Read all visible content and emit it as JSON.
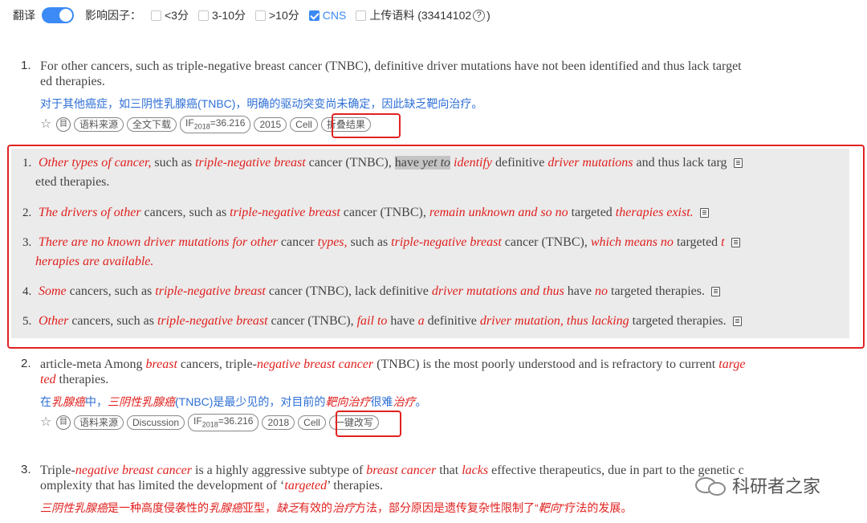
{
  "filter": {
    "translate_label": "翻译",
    "impact_label": "影响因子：",
    "options": [
      {
        "label": "<3分",
        "checked": false
      },
      {
        "label": "3-10分",
        "checked": false
      },
      {
        "label": ">10分",
        "checked": false
      },
      {
        "label": "CNS",
        "checked": true
      },
      {
        "label": "上传语料 (33414102",
        "checked": false
      }
    ],
    "help": "?",
    "close_paren": ")"
  },
  "entries": [
    {
      "num": "1.",
      "en_line1": "For other cancers, such as triple-negative breast cancer (TNBC), definitive driver mutations have not been identified and thus lack target",
      "en_line2": "ed therapies.",
      "zh": "对于其他癌症，如三阴性乳腺癌(TNBC)，明确的驱动突变尚未确定，因此缺乏靶向治疗。",
      "tags": [
        "语料来源",
        "全文下载",
        "IF",
        "2018",
        "=36.216",
        "2015",
        "Cell",
        "折叠结果"
      ],
      "icon_text": "目"
    },
    {
      "num": "2.",
      "en_parts": [
        "article-meta Among ",
        "breast",
        " cancers, triple-",
        "negative breast cancer",
        " (TNBC) is the most poorly understood and is refractory to current ",
        "targe"
      ],
      "en_line2_parts": [
        "ted",
        " therapies."
      ],
      "zh_parts": [
        "在",
        "乳腺癌",
        "中，",
        "三阴性乳腺癌",
        "(TNBC)是最少见的，对目前的",
        "靶向治疗",
        "很难",
        "治疗",
        "。"
      ],
      "tags": [
        "语料来源",
        "Discussion",
        "IF",
        "2018",
        "=36.216",
        "2018",
        "Cell",
        "一键改写"
      ],
      "icon_text": "目"
    },
    {
      "num": "3.",
      "en_parts": [
        "Triple-",
        "negative breast cancer",
        " is a highly aggressive subtype of ",
        "breast cancer",
        " that ",
        "lacks",
        " effective therapeutics, due in part to the genetic c"
      ],
      "en_line2_parts": [
        "omplexity that has limited the development of ‘",
        "targeted",
        "’ therapies."
      ],
      "zh_parts": [
        "三阴性乳腺癌",
        "是一种高度侵袭性的",
        "乳腺癌",
        "亚型，",
        "缺乏",
        "有效的",
        "治疗",
        "方法，部分原因是遗传复杂性限制了“",
        "靶向",
        "”疗法的发展。"
      ]
    }
  ],
  "alternatives": [
    {
      "num": "1.",
      "parts": [
        "Other types of cancer,",
        " such as ",
        "triple-negative breast",
        " cancer (TNBC), ",
        "have ",
        "yet to",
        " ",
        "identify",
        " definitive ",
        "driver mutations",
        " and thus lack targ"
      ],
      "line2": "eted therapies."
    },
    {
      "num": "2.",
      "parts": [
        "The drivers of other",
        " cancers, such as ",
        "triple-negative breast",
        " cancer (TNBC), ",
        "remain unknown and so no",
        " targeted ",
        "therapies exist."
      ]
    },
    {
      "num": "3.",
      "parts": [
        "There are no known driver mutations for other",
        " cancer ",
        "types,",
        " such as ",
        "triple-negative breast",
        " cancer (TNBC), ",
        "which means no",
        " targeted ",
        "t"
      ],
      "line2": "herapies are available."
    },
    {
      "num": "4.",
      "parts": [
        "Some",
        " cancers, such as ",
        "triple-negative breast",
        " cancer (TNBC), lack definitive ",
        "driver mutations and thus",
        " have ",
        "no",
        " targeted therapies."
      ]
    },
    {
      "num": "5.",
      "parts": [
        "Other",
        " cancers, such as ",
        "triple-negative breast",
        " cancer (TNBC), ",
        "fail to",
        " have ",
        "a",
        " definitive ",
        "driver mutation, thus lacking",
        " targeted therapies."
      ]
    }
  ],
  "watermark": "科研者之家"
}
